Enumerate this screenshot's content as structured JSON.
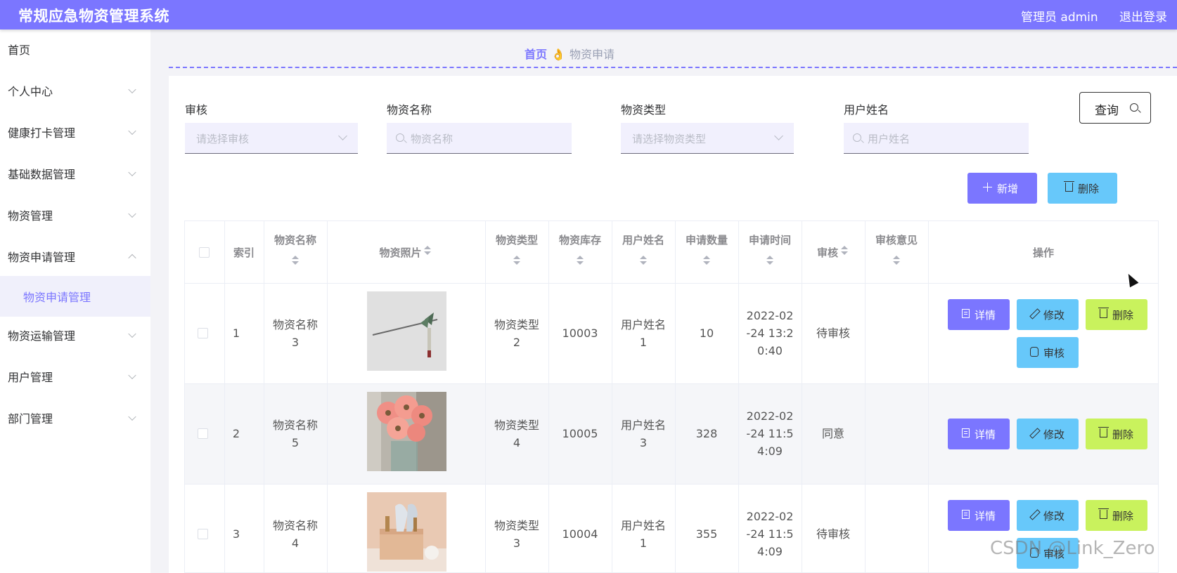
{
  "header": {
    "title": "常规应急物资管理系统",
    "admin": "管理员 admin",
    "logout": "退出登录"
  },
  "sidebar": {
    "items": [
      {
        "label": "首页"
      },
      {
        "label": "个人中心"
      },
      {
        "label": "健康打卡管理"
      },
      {
        "label": "基础数据管理"
      },
      {
        "label": "物资管理"
      },
      {
        "label": "物资申请管理"
      },
      {
        "label": "物资运输管理"
      },
      {
        "label": "用户管理"
      },
      {
        "label": "部门管理"
      }
    ],
    "sub_item": "物资申请管理"
  },
  "breadcrumb": {
    "home": "首页",
    "separator": "👌",
    "current": "物资申请"
  },
  "filters": {
    "audit": {
      "label": "审核",
      "placeholder": "请选择审核"
    },
    "name": {
      "label": "物资名称",
      "placeholder": "物资名称"
    },
    "type": {
      "label": "物资类型",
      "placeholder": "请选择物资类型"
    },
    "user": {
      "label": "用户姓名",
      "placeholder": "用户姓名"
    },
    "query_label": "查询"
  },
  "actions": {
    "add": "新增",
    "delete": "删除"
  },
  "table": {
    "headers": [
      "索引",
      "物资名称",
      "物资照片",
      "物资类型",
      "物资库存",
      "用户姓名",
      "申请数量",
      "申请时间",
      "审核",
      "审核意见",
      "操作"
    ],
    "rows": [
      {
        "index": "1",
        "name_a": "物资名称",
        "name_b": "3",
        "type_a": "物资类型",
        "type_b": "2",
        "stock": "10003",
        "user_a": "用户姓名",
        "user_b": "1",
        "qty": "10",
        "time_a": "2022-02",
        "time_b": "-24 13:2",
        "time_c": "0:40",
        "audit": "待审核",
        "opinion": ""
      },
      {
        "index": "2",
        "name_a": "物资名称",
        "name_b": "5",
        "type_a": "物资类型",
        "type_b": "4",
        "stock": "10005",
        "user_a": "用户姓名",
        "user_b": "3",
        "qty": "328",
        "time_a": "2022-02",
        "time_b": "-24 11:5",
        "time_c": "4:09",
        "audit": "同意",
        "opinion": ""
      },
      {
        "index": "3",
        "name_a": "物资名称",
        "name_b": "4",
        "type_a": "物资类型",
        "type_b": "3",
        "stock": "10004",
        "user_a": "用户姓名",
        "user_b": "1",
        "qty": "355",
        "time_a": "2022-02",
        "time_b": "-24 11:5",
        "time_c": "4:09",
        "audit": "待审核",
        "opinion": ""
      }
    ],
    "row_buttons": {
      "detail": "详情",
      "edit": "修改",
      "delete": "删除",
      "audit": "审核"
    }
  },
  "watermark": "CSDN @Link_Zero",
  "colors": {
    "accent": "#7b76ff",
    "blue_button": "#67c8fa",
    "lime_button": "#c9f25d"
  }
}
